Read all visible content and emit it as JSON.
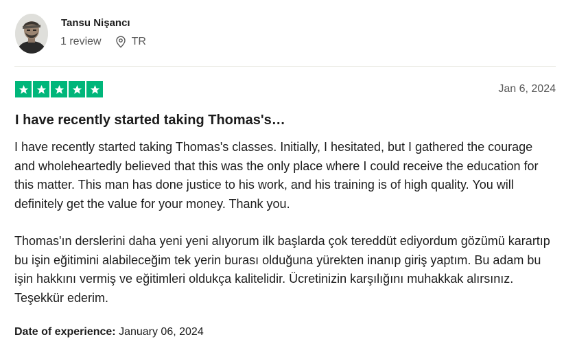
{
  "reviewer": {
    "name": "Tansu Nişancı",
    "review_count": "1 review",
    "location": "TR",
    "avatar_icon": "avatar-photo",
    "location_icon": "map-pin-icon"
  },
  "review": {
    "rating": 5,
    "rating_max": 5,
    "star_color": "#00b67a",
    "date": "Jan 6, 2024",
    "title": "I have recently started taking Thomas's…",
    "paragraphs": [
      "I have recently started taking Thomas's classes. Initially, I hesitated, but I gathered the courage and wholeheartedly believed that this was the only place where I could receive the education for this matter. This man has done justice to his work, and his training is of high quality. You will definitely get the value for your money. Thank you.",
      "Thomas'ın derslerini daha yeni yeni alıyorum ilk başlarda çok tereddüt ediyordum gözümü karartıp bu işin eğitimini alabileceğim tek yerin burası olduğuna yürekten inanıp giriş yaptım. Bu adam bu işin hakkını vermiş ve eğitimleri oldukça kalitelidir. Ücretinizin karşılığını muhakkak alırsınız. Teşekkür ederim."
    ],
    "experience_label": "Date of experience:",
    "experience_date": "January 06, 2024"
  }
}
